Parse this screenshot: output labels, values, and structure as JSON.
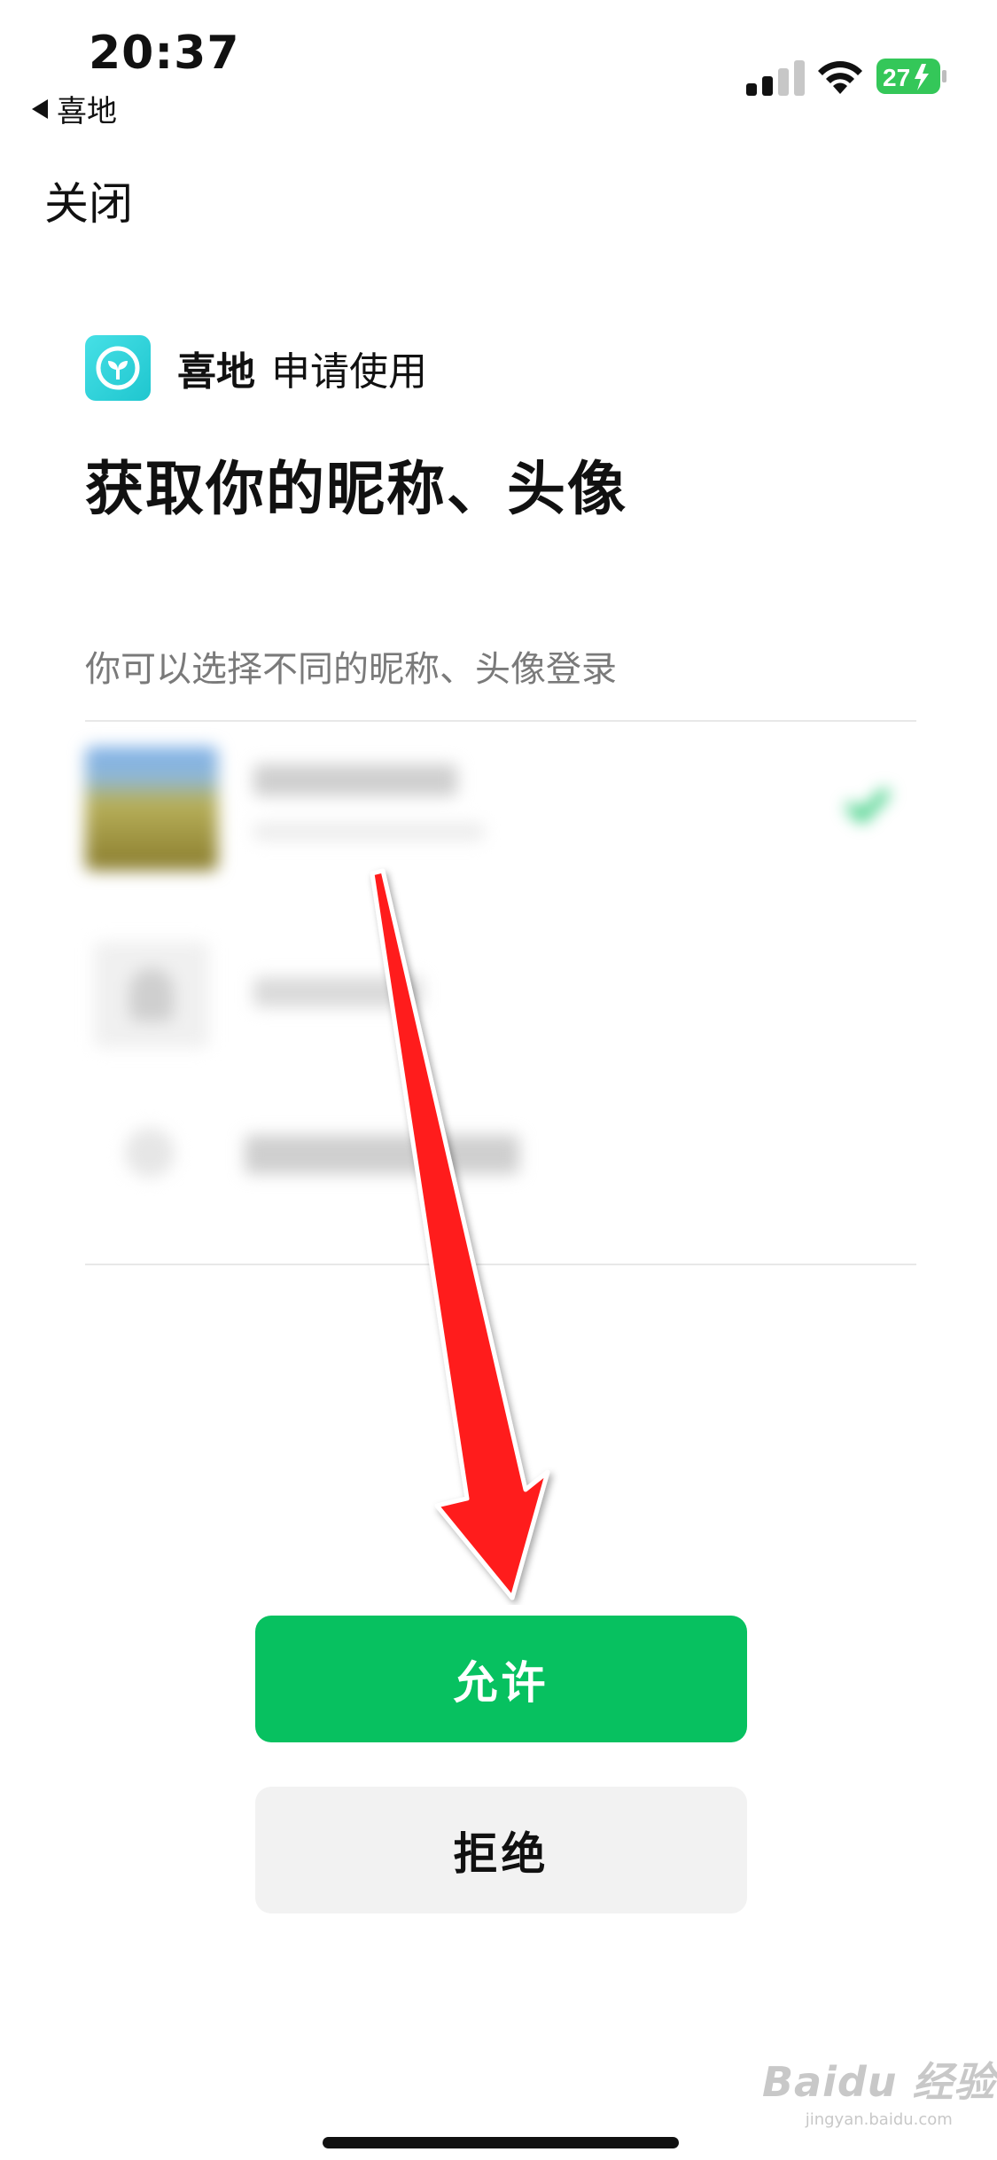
{
  "status_bar": {
    "time": "20:37",
    "back_app_label": "喜地",
    "battery_level": "27",
    "battery_color": "#34c759"
  },
  "nav": {
    "close_label": "关闭"
  },
  "auth": {
    "app_name": "喜地",
    "request_text": "申请使用",
    "title": "获取你的昵称、头像",
    "hint": "你可以选择不同的昵称、头像登录",
    "accounts_blurred": true
  },
  "buttons": {
    "allow_label": "允许",
    "deny_label": "拒绝",
    "allow_color": "#07c160"
  },
  "watermark": {
    "main": "Baidu 经验",
    "sub": "jingyan.baidu.com"
  },
  "icons": [
    "back-arrow-icon",
    "signal-icon",
    "wifi-icon",
    "battery-icon",
    "app-logo-icon",
    "check-icon",
    "annotation-arrow-icon"
  ]
}
